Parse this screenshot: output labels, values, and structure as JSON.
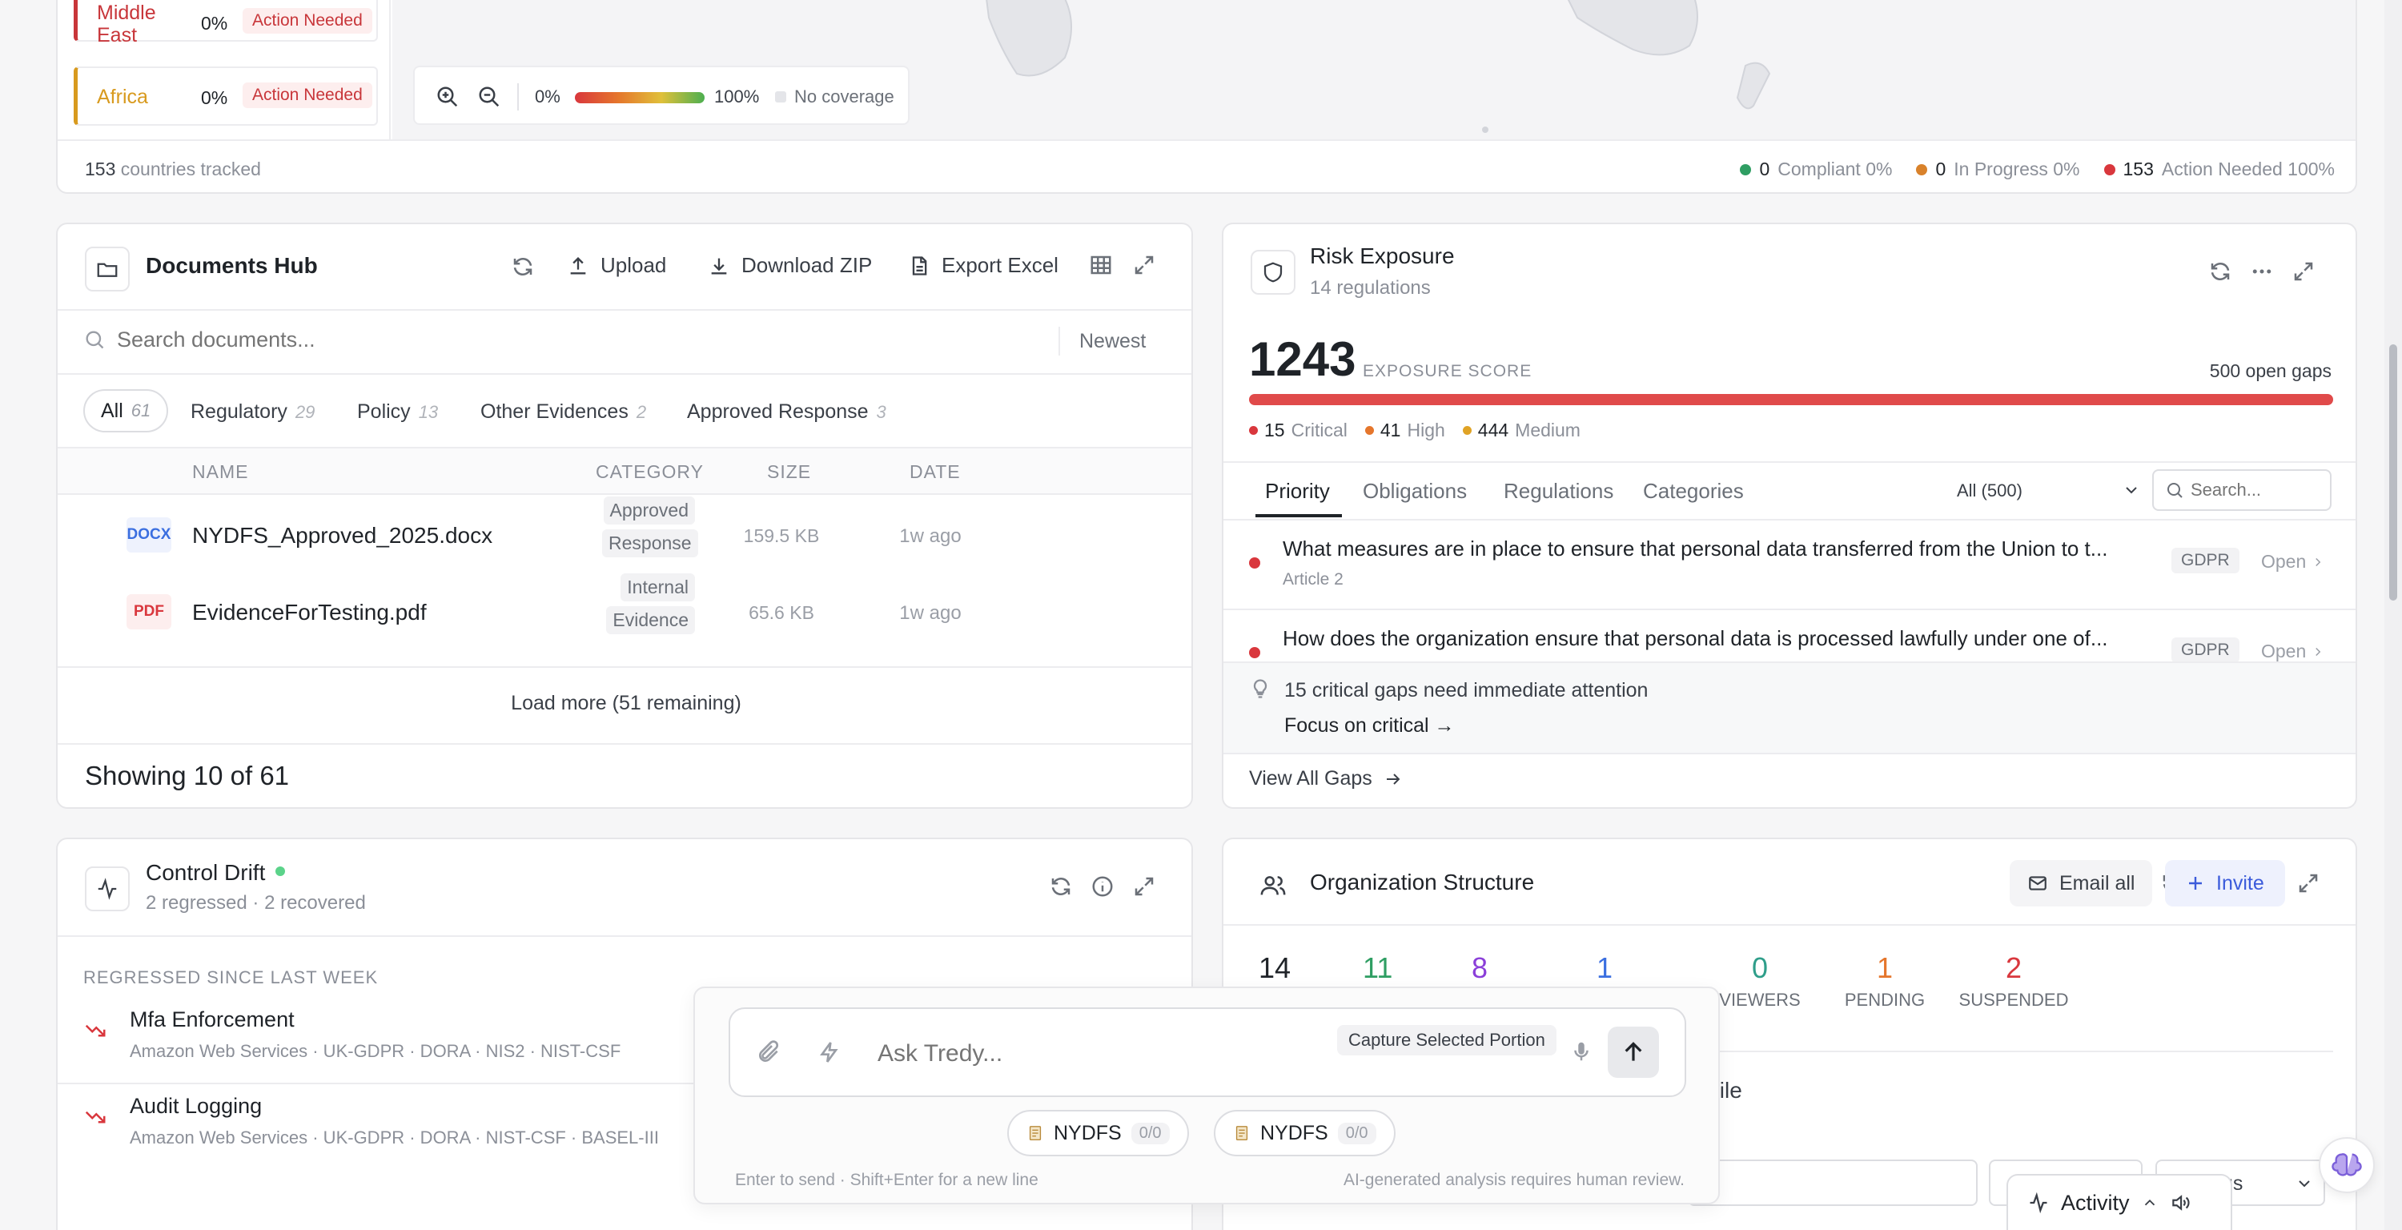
{
  "map": {
    "regions": [
      {
        "name": "Middle East",
        "pct": "0%",
        "status": "Action Needed",
        "color": "#c8363a"
      },
      {
        "name": "Africa",
        "pct": "0%",
        "status": "Action Needed",
        "color": "#d89a1e"
      }
    ],
    "legend_min": "0%",
    "legend_max": "100%",
    "no_coverage": "No coverage",
    "countries_count": "153",
    "countries_label": "countries tracked",
    "stats": [
      {
        "count": "0",
        "label": "Compliant 0%",
        "color": "#2f9e63"
      },
      {
        "count": "0",
        "label": "In Progress 0%",
        "color": "#d9822b"
      },
      {
        "count": "153",
        "label": "Action Needed 100%",
        "color": "#d9373d"
      }
    ]
  },
  "documents": {
    "title": "Documents Hub",
    "upload": "Upload",
    "download_zip": "Download ZIP",
    "export_excel": "Export Excel",
    "search_placeholder": "Search documents...",
    "sort": "Newest",
    "filters": [
      {
        "label": "All",
        "count": "61"
      },
      {
        "label": "Regulatory",
        "count": "29"
      },
      {
        "label": "Policy",
        "count": "13"
      },
      {
        "label": "Other Evidences",
        "count": "2"
      },
      {
        "label": "Approved Response",
        "count": "3"
      }
    ],
    "columns": {
      "name": "NAME",
      "category": "CATEGORY",
      "size": "SIZE",
      "date": "DATE"
    },
    "rows": [
      {
        "type": "DOCX",
        "name": "NYDFS_Approved_2025.docx",
        "cat1": "Approved",
        "cat2": "Response",
        "size": "159.5 KB",
        "date": "1w ago"
      },
      {
        "type": "PDF",
        "name": "EvidenceForTesting.pdf",
        "cat1": "Internal",
        "cat2": "Evidence",
        "size": "65.6 KB",
        "date": "1w ago"
      }
    ],
    "load_more": "Load more (51 remaining)",
    "showing": "Showing 10 of 61"
  },
  "risk": {
    "title": "Risk Exposure",
    "subtitle": "14 regulations",
    "score": "1243",
    "score_label": "EXPOSURE SCORE",
    "open_gaps": "500 open gaps",
    "severity": [
      {
        "count": "15",
        "label": "Critical",
        "color": "#d9373d"
      },
      {
        "count": "41",
        "label": "High",
        "color": "#e5762c"
      },
      {
        "count": "444",
        "label": "Medium",
        "color": "#e0a325"
      }
    ],
    "tabs": [
      "Priority",
      "Obligations",
      "Regulations",
      "Categories"
    ],
    "filter": "All (500)",
    "search_placeholder": "Search...",
    "gaps": [
      {
        "text": "What measures are in place to ensure that personal data transferred from the Union to t...",
        "article": "Article 2",
        "tag": "GDPR",
        "action": "Open"
      },
      {
        "text": "How does the organization ensure that personal data is processed lawfully under one of...",
        "tag": "GDPR",
        "action": "Open"
      }
    ],
    "hint": "15 critical gaps need immediate attention",
    "focus": "Focus on critical →",
    "view_all": "View All Gaps"
  },
  "drift": {
    "title": "Control Drift",
    "subtitle": "2 regressed · 2 recovered",
    "section": "REGRESSED SINCE LAST WEEK",
    "items": [
      {
        "name": "Mfa Enforcement",
        "meta": "Amazon Web Services · UK-GDPR · DORA · NIS2 · NIST-CSF"
      },
      {
        "name": "Audit Logging",
        "meta": "Amazon Web Services · UK-GDPR · DORA · NIST-CSF · BASEL-III"
      }
    ]
  },
  "org": {
    "title": "Organization Structure",
    "email_all": "Email all",
    "invite": "Invite",
    "stats": [
      {
        "value": "14",
        "label": "",
        "color": "#1f2328"
      },
      {
        "value": "11",
        "label": "",
        "color": "#2f9e63"
      },
      {
        "value": "8",
        "label": "",
        "color": "#8b3fd9"
      },
      {
        "value": "1",
        "label": "",
        "color": "#3b6fe0"
      },
      {
        "value": "0",
        "label": "VIEWERS",
        "color": "#2f9e8a"
      },
      {
        "value": "1",
        "label": "PENDING",
        "color": "#e5762c"
      },
      {
        "value": "2",
        "label": "SUSPENDED",
        "color": "#d9373d"
      }
    ],
    "profile_fragment": "file",
    "status_fragment": "tus"
  },
  "chat": {
    "placeholder": "Ask Tredy...",
    "capture": "Capture Selected Portion",
    "chips": [
      {
        "label": "NYDFS",
        "count": "0/0"
      },
      {
        "label": "NYDFS",
        "count": "0/0"
      }
    ],
    "hint_left": "Enter to send · Shift+Enter for a new line",
    "hint_right": "AI-generated analysis requires human review."
  },
  "activity": {
    "label": "Activity"
  }
}
